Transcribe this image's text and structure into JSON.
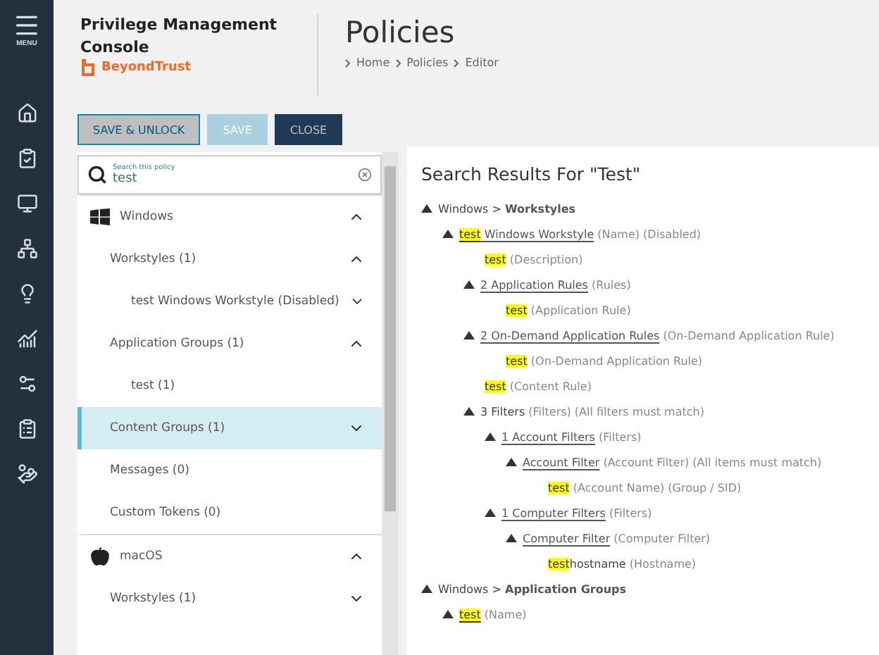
{
  "nav": {
    "menu_label": "MENU"
  },
  "header": {
    "product": "Privilege Management Console",
    "brand": "BeyondTrust",
    "title": "Policies",
    "breadcrumb": [
      "Home",
      "Policies",
      "Editor"
    ]
  },
  "toolbar": {
    "buttons": [
      {
        "label": "SAVE & UNLOCK",
        "kind": "outline",
        "disabled": false
      },
      {
        "label": "SAVE",
        "kind": "primary",
        "disabled": true
      },
      {
        "label": "CLOSE",
        "kind": "dark",
        "disabled": false
      }
    ]
  },
  "search": {
    "placeholder": "Search this policy",
    "value": "test"
  },
  "policy_tree": [
    {
      "label": "Windows",
      "kind": "windows",
      "expanded": true,
      "selected": false,
      "children": [
        {
          "label": "Workstyles (1)",
          "expanded": true,
          "selected": false,
          "children": [
            {
              "label": "test Windows Workstyle (Disabled)",
              "expanded": false,
              "selected": false
            }
          ]
        },
        {
          "label": "Application Groups (1)",
          "expanded": true,
          "selected": false,
          "children": [
            {
              "label": "test (1)",
              "selected": false
            }
          ]
        },
        {
          "label": "Content Groups (1)",
          "expanded": false,
          "selected": true
        },
        {
          "label": "Messages (0)",
          "selected": false
        },
        {
          "label": "Custom Tokens (0)",
          "selected": false
        }
      ]
    },
    {
      "label": "macOS",
      "kind": "apple",
      "expanded": true,
      "selected": false,
      "children": [
        {
          "label": "Workstyles (1)",
          "expanded": false,
          "selected": false
        }
      ]
    }
  ],
  "results": {
    "title": "Search Results For \"Test\"",
    "tree": [
      {
        "expanded": true,
        "segments": [
          {
            "kind": "plain",
            "text": "Windows > "
          },
          {
            "kind": "strong",
            "text": "Workstyles"
          }
        ],
        "children": [
          {
            "expanded": true,
            "segments": [
              {
                "kind": "match-link",
                "text": "test"
              },
              {
                "kind": "link",
                "text": " Windows Workstyle"
              },
              {
                "kind": "note",
                "text": " (Name) (Disabled)"
              }
            ],
            "children": [
              {
                "segments": [
                  {
                    "kind": "match",
                    "text": "test"
                  },
                  {
                    "kind": "note",
                    "text": " (Description)"
                  }
                ]
              },
              {
                "expanded": true,
                "segments": [
                  {
                    "kind": "link",
                    "text": "2 Application Rules"
                  },
                  {
                    "kind": "note",
                    "text": " (Rules)"
                  }
                ],
                "children": [
                  {
                    "segments": [
                      {
                        "kind": "match",
                        "text": "test"
                      },
                      {
                        "kind": "note",
                        "text": " (Application Rule)"
                      }
                    ]
                  }
                ]
              },
              {
                "expanded": true,
                "segments": [
                  {
                    "kind": "link",
                    "text": "2 On-Demand Application Rules"
                  },
                  {
                    "kind": "note",
                    "text": " (On-Demand Application Rule)"
                  }
                ],
                "children": [
                  {
                    "segments": [
                      {
                        "kind": "match",
                        "text": "test"
                      },
                      {
                        "kind": "note",
                        "text": " (On-Demand Application Rule)"
                      }
                    ]
                  }
                ]
              },
              {
                "segments": [
                  {
                    "kind": "match",
                    "text": "test"
                  },
                  {
                    "kind": "note",
                    "text": " (Content Rule)"
                  }
                ]
              },
              {
                "expanded": true,
                "segments": [
                  {
                    "kind": "plain",
                    "text": "3 Filters"
                  },
                  {
                    "kind": "note",
                    "text": " (Filters) (All filters must match)"
                  }
                ],
                "children": [
                  {
                    "expanded": true,
                    "segments": [
                      {
                        "kind": "link",
                        "text": "1 Account Filters"
                      },
                      {
                        "kind": "note",
                        "text": " (Filters)"
                      }
                    ],
                    "children": [
                      {
                        "expanded": true,
                        "segments": [
                          {
                            "kind": "link",
                            "text": "Account Filter"
                          },
                          {
                            "kind": "note",
                            "text": " (Account Filter) (All items must match)"
                          }
                        ],
                        "children": [
                          {
                            "segments": [
                              {
                                "kind": "match",
                                "text": "test"
                              },
                              {
                                "kind": "note",
                                "text": " (Account Name) (Group / SID)"
                              }
                            ]
                          }
                        ]
                      }
                    ]
                  },
                  {
                    "expanded": true,
                    "segments": [
                      {
                        "kind": "link",
                        "text": "1 Computer Filters"
                      },
                      {
                        "kind": "note",
                        "text": " (Filters)"
                      }
                    ],
                    "children": [
                      {
                        "expanded": true,
                        "segments": [
                          {
                            "kind": "link",
                            "text": "Computer Filter"
                          },
                          {
                            "kind": "note",
                            "text": " (Computer Filter)"
                          }
                        ],
                        "children": [
                          {
                            "segments": [
                              {
                                "kind": "match",
                                "text": "test"
                              },
                              {
                                "kind": "plain",
                                "text": "hostname"
                              },
                              {
                                "kind": "note",
                                "text": " (Hostname)"
                              }
                            ]
                          }
                        ]
                      }
                    ]
                  }
                ]
              }
            ]
          }
        ]
      },
      {
        "expanded": true,
        "segments": [
          {
            "kind": "plain",
            "text": "Windows > "
          },
          {
            "kind": "strong",
            "text": "Application Groups"
          }
        ],
        "children": [
          {
            "expanded": true,
            "segments": [
              {
                "kind": "match-link",
                "text": "test"
              },
              {
                "kind": "note",
                "text": " (Name)"
              }
            ]
          }
        ]
      }
    ]
  }
}
